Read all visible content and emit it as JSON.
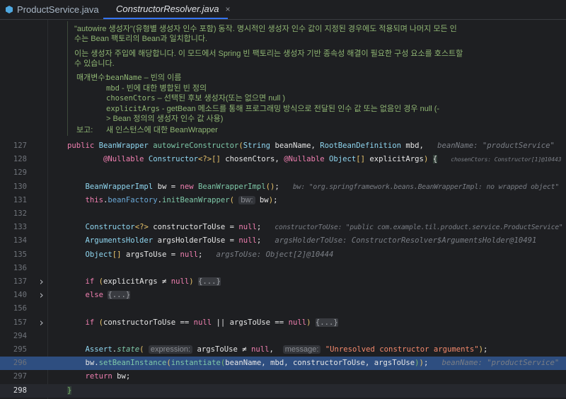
{
  "tabs": [
    {
      "label": "ProductService.java",
      "active": false
    },
    {
      "label": "ConstructorResolver.java",
      "active": true,
      "close": "×"
    }
  ],
  "doc": {
    "lines": [
      "\"autowire 생성자\"(유형별 생성자 인수 포함) 동작. 명시적인 생성자 인수 값이 지정된 경우에도 적용되며 나머지 모든 인",
      "수는 Bean 팩토리의 Bean과 일치합니다.",
      "이는 생성자 주입에 해당합니다. 이 모드에서 Spring 빈 팩토리는 생성자 기반 종속성 해결이 필요한 구성 요소를 호스트할",
      "수 있습니다."
    ],
    "params_label": "매개변수:",
    "params": [
      {
        "name": "beanName",
        "desc": " – 빈의 이름"
      },
      {
        "name": "mbd",
        "desc": " - 빈에 대한 병합된 빈 정의"
      },
      {
        "name": "chosenCtors",
        "desc": " – 선택된 후보 생성자(또는 없으면 null )"
      },
      {
        "name": "explicitArgs",
        "desc": " - getBean 메소드를 통해 프로그래밍 방식으로 전달된 인수 값 또는 없음인 경우 null (-"
      }
    ],
    "param_cont": "> Bean 정의의 생성자 인수 값 사용)",
    "returns_label": "보고:",
    "returns": "새 인스턴스에 대한 BeanWrapper"
  },
  "lines": [
    {
      "n": "127",
      "tokens": [
        [
          "kw",
          "public "
        ],
        [
          "ty",
          "BeanWrapper "
        ],
        [
          "fn",
          "autowireConstructor"
        ],
        [
          "pr",
          "("
        ],
        [
          "ty",
          "String "
        ],
        [
          "",
          "beanName, "
        ],
        [
          "ty",
          "RootBeanDefinition "
        ],
        [
          "",
          "mbd,   "
        ],
        [
          "hint",
          "beanName: \"productService\""
        ]
      ]
    },
    {
      "n": "128",
      "tokens": [
        [
          "",
          "        "
        ],
        [
          "kw",
          "@Nullable "
        ],
        [
          "ty",
          "Constructor"
        ],
        [
          "pr",
          "<?>[] "
        ],
        [
          "",
          "chosenCtors, "
        ],
        [
          "kw",
          "@Nullable "
        ],
        [
          "ty",
          "Object"
        ],
        [
          "pr",
          "[] "
        ],
        [
          "",
          "explicitArgs"
        ],
        [
          "pr",
          ") "
        ],
        [
          "brace",
          "{"
        ],
        [
          "",
          "   "
        ],
        [
          "hint",
          "chosenCtors: Constructor[1]@10443"
        ]
      ]
    },
    {
      "n": "129",
      "tokens": []
    },
    {
      "n": "130",
      "tokens": [
        [
          "",
          "    "
        ],
        [
          "ty",
          "BeanWrapperImpl "
        ],
        [
          "",
          "bw = "
        ],
        [
          "kw",
          "new "
        ],
        [
          "fn",
          "BeanWrapperImpl"
        ],
        [
          "pr",
          "()"
        ],
        [
          "",
          ";   "
        ],
        [
          "hint",
          "bw: \"org.springframework.beans.BeanWrapperImpl: no wrapped object\""
        ]
      ]
    },
    {
      "n": "131",
      "tokens": [
        [
          "",
          "    "
        ],
        [
          "kw",
          "this"
        ],
        [
          "",
          "."
        ],
        [
          "fld",
          "beanFactory"
        ],
        [
          "",
          "."
        ],
        [
          "fn",
          "initBeanWrapper"
        ],
        [
          "pr",
          "( "
        ],
        [
          "phint",
          "bw:"
        ],
        [
          "",
          " bw"
        ],
        [
          "pr",
          ")"
        ],
        [
          "",
          ";"
        ]
      ]
    },
    {
      "n": "132",
      "tokens": []
    },
    {
      "n": "133",
      "tokens": [
        [
          "",
          "    "
        ],
        [
          "ty",
          "Constructor"
        ],
        [
          "pr",
          "<?> "
        ],
        [
          "",
          "constructorToUse = "
        ],
        [
          "kw",
          "null"
        ],
        [
          "",
          ";   "
        ],
        [
          "hint",
          "constructorToUse: \"public com.example.til.product.service.ProductService\""
        ]
      ]
    },
    {
      "n": "134",
      "tokens": [
        [
          "",
          "    "
        ],
        [
          "ty",
          "ArgumentsHolder "
        ],
        [
          "",
          "argsHolderToUse = "
        ],
        [
          "kw",
          "null"
        ],
        [
          "",
          ";   "
        ],
        [
          "hint",
          "argsHolderToUse: ConstructorResolver$ArgumentsHolder@10491"
        ]
      ]
    },
    {
      "n": "135",
      "tokens": [
        [
          "",
          "    "
        ],
        [
          "ty",
          "Object"
        ],
        [
          "pr",
          "[] "
        ],
        [
          "",
          "argsToUse = "
        ],
        [
          "kw",
          "null"
        ],
        [
          "",
          ";   "
        ],
        [
          "hint",
          "argsToUse: Object[2]@10444"
        ]
      ]
    },
    {
      "n": "136",
      "tokens": []
    },
    {
      "n": "137",
      "fold": true,
      "tokens": [
        [
          "",
          "    "
        ],
        [
          "kw",
          "if "
        ],
        [
          "pr",
          "("
        ],
        [
          "",
          "explicitArgs ≠ "
        ],
        [
          "kw",
          "null"
        ],
        [
          "pr",
          ") "
        ],
        [
          "foldbox",
          "{...}"
        ]
      ]
    },
    {
      "n": "140",
      "fold": true,
      "tokens": [
        [
          "",
          "    "
        ],
        [
          "kw",
          "else "
        ],
        [
          "foldbox",
          "{...}"
        ]
      ]
    },
    {
      "n": "156",
      "tokens": []
    },
    {
      "n": "157",
      "fold": true,
      "tokens": [
        [
          "",
          "    "
        ],
        [
          "kw",
          "if "
        ],
        [
          "pr",
          "("
        ],
        [
          "",
          "constructorToUse == "
        ],
        [
          "kw",
          "null"
        ],
        [
          "",
          " || argsToUse == "
        ],
        [
          "kw",
          "null"
        ],
        [
          "pr",
          ") "
        ],
        [
          "foldbox",
          "{...}"
        ]
      ]
    },
    {
      "n": "294",
      "tokens": []
    },
    {
      "n": "295",
      "tokens": [
        [
          "",
          "    "
        ],
        [
          "ty",
          "Assert"
        ],
        [
          "",
          "."
        ],
        [
          "fn it",
          "state"
        ],
        [
          "pr",
          "( "
        ],
        [
          "phint",
          "expression:"
        ],
        [
          "",
          " argsToUse ≠ "
        ],
        [
          "kw",
          "null"
        ],
        [
          ",",
          ",  "
        ],
        [
          "phint",
          "message:"
        ],
        [
          "st",
          " \"Unresolved constructor arguments\""
        ],
        [
          "pr",
          ")"
        ],
        [
          "",
          ";"
        ]
      ]
    },
    {
      "n": "296",
      "sel": true,
      "tokens": [
        [
          "",
          "    bw."
        ],
        [
          "fn",
          "setBeanInstance"
        ],
        [
          "pr",
          "("
        ],
        [
          "fn",
          "instantiate"
        ],
        [
          "pg",
          "("
        ],
        [
          "",
          "beanName, mbd, constructorToUse, argsToUse"
        ],
        [
          "pg",
          ")"
        ],
        [
          "pr",
          ")"
        ],
        [
          "",
          ";   "
        ],
        [
          "hint",
          "beanName: \"productService\""
        ]
      ]
    },
    {
      "n": "297",
      "tokens": [
        [
          "",
          "    "
        ],
        [
          "kw",
          "return "
        ],
        [
          "",
          "bw;"
        ]
      ]
    },
    {
      "n": "298",
      "cur": true,
      "tokens": [
        [
          "pg brace",
          "}"
        ]
      ]
    }
  ],
  "colors": {
    "selection": "#2e4e80",
    "keyword": "#ef7fb0",
    "type": "#8fd6f0",
    "doc": "#8fb573",
    "accent": "#3574f0"
  }
}
